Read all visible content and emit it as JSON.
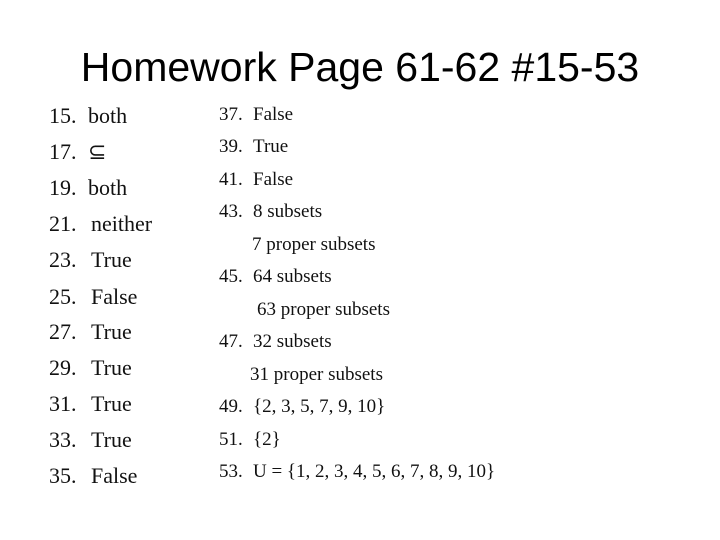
{
  "title": "Homework Page 61-62 #15-53",
  "column1": [
    {
      "num": "15.",
      "text": "both"
    },
    {
      "num": "17.",
      "text": "⊆"
    },
    {
      "num": "19.",
      "text": "both"
    },
    {
      "num": "21.",
      "text": "neither"
    },
    {
      "num": "23.",
      "text": "True"
    },
    {
      "num": "25.",
      "text": "False"
    },
    {
      "num": "27.",
      "text": "True"
    },
    {
      "num": "29.",
      "text": "True"
    },
    {
      "num": "31.",
      "text": "True"
    },
    {
      "num": "33.",
      "text": "True"
    },
    {
      "num": "35.",
      "text": "False"
    }
  ],
  "column2": [
    {
      "num": "37.",
      "text": "False"
    },
    {
      "num": "39.",
      "text": "True"
    },
    {
      "num": "41.",
      "text": "False"
    },
    {
      "num": "43.",
      "text": "8 subsets"
    },
    {
      "num": "",
      "text": "7 proper subsets"
    },
    {
      "num": "45.",
      "text": "64 subsets"
    },
    {
      "num": "",
      "text": "63 proper subsets"
    },
    {
      "num": "47.",
      "text": "32 subsets"
    },
    {
      "num": "",
      "text": "31 proper subsets"
    },
    {
      "num": "49.",
      "text": "{2, 3, 5, 7, 9, 10}"
    },
    {
      "num": "51.",
      "text": "{2}"
    },
    {
      "num": "53.",
      "text": "U = {1, 2, 3, 4, 5, 6, 7, 8, 9, 10}"
    }
  ]
}
